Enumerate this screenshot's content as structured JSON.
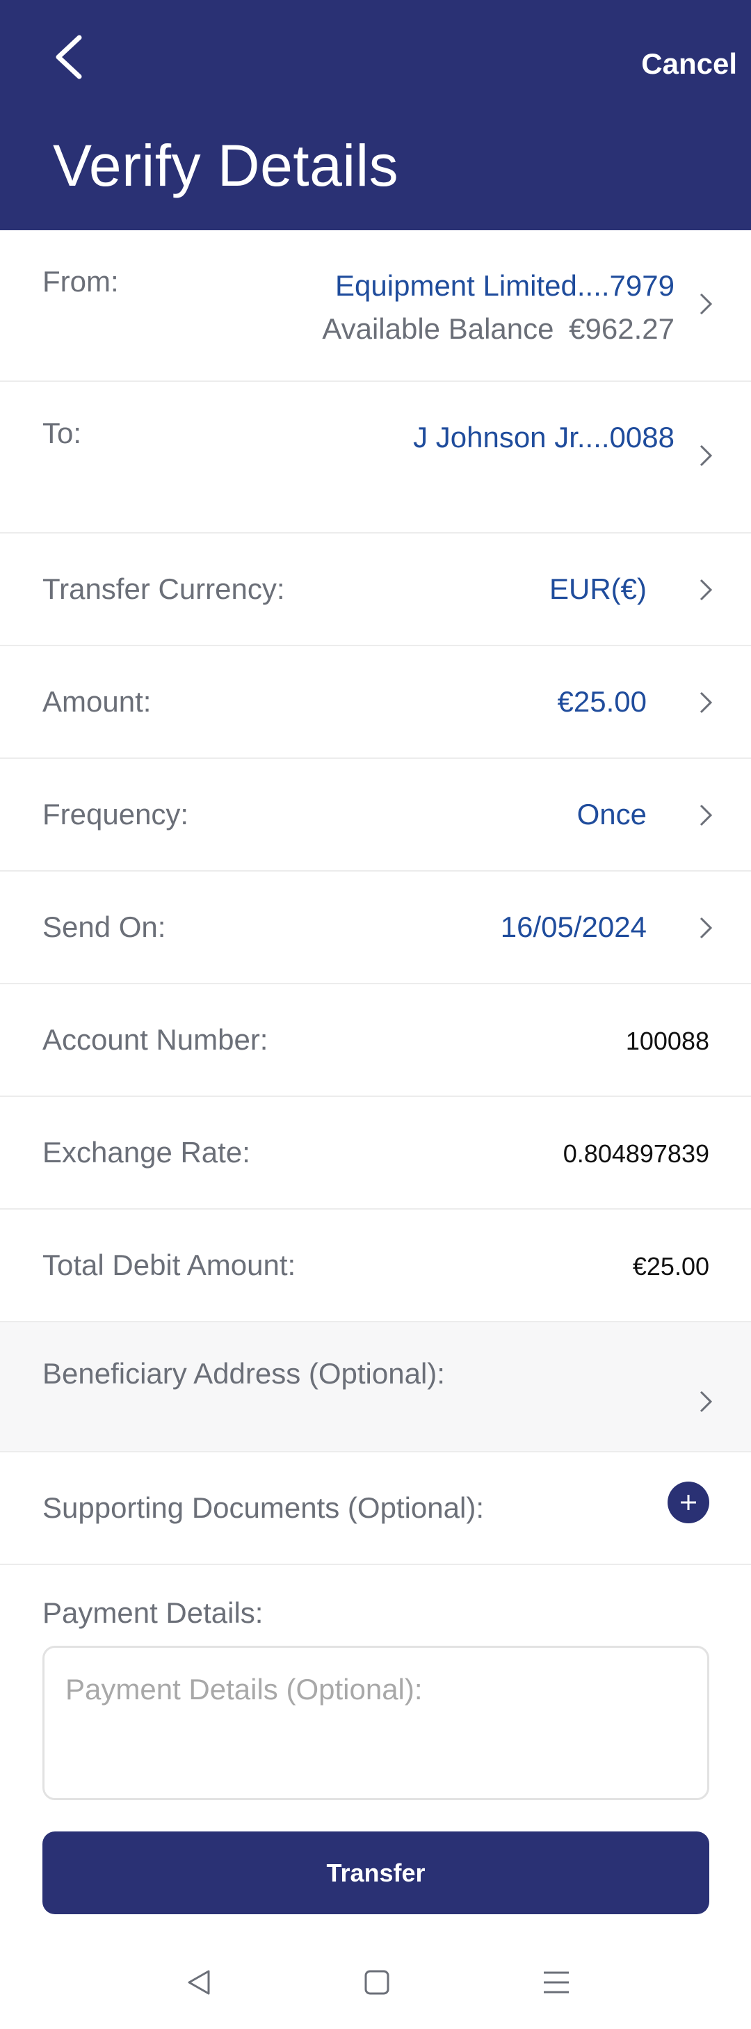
{
  "header": {
    "title": "Verify Details",
    "cancel_label": "Cancel"
  },
  "from": {
    "label": "From:",
    "account": "Equipment Limited....7979",
    "balance_label": "Available Balance",
    "balance_value": "€962.27"
  },
  "to": {
    "label": "To:",
    "account": "J Johnson Jr....0088"
  },
  "currency": {
    "label": "Transfer Currency:",
    "value": "EUR(€)"
  },
  "amount": {
    "label": "Amount:",
    "value": "€25.00"
  },
  "frequency": {
    "label": "Frequency:",
    "value": "Once"
  },
  "send_on": {
    "label": "Send On:",
    "value": "16/05/2024"
  },
  "account_number": {
    "label": "Account Number:",
    "value": "100088"
  },
  "exchange_rate": {
    "label": "Exchange Rate:",
    "value": "0.804897839"
  },
  "total_debit": {
    "label": "Total Debit Amount:",
    "value": "€25.00"
  },
  "beneficiary_address": {
    "label": "Beneficiary Address (Optional):"
  },
  "supporting_documents": {
    "label": "Supporting Documents (Optional):"
  },
  "payment_details": {
    "label": "Payment Details:",
    "placeholder": "Payment Details (Optional):"
  },
  "transfer_label": "Transfer",
  "colors": {
    "brand": "#2a3174",
    "link": "#1f4c9c",
    "label": "#6b6f78"
  }
}
